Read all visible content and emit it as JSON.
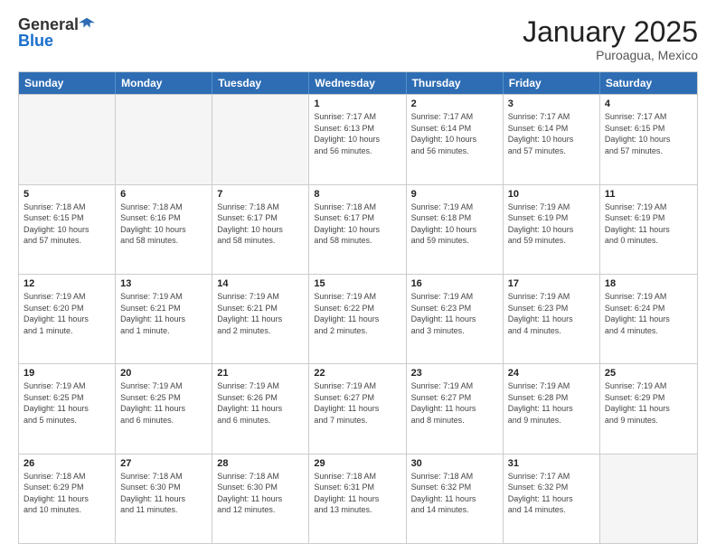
{
  "header": {
    "logo_general": "General",
    "logo_blue": "Blue",
    "month_year": "January 2025",
    "location": "Puroagua, Mexico"
  },
  "days_of_week": [
    "Sunday",
    "Monday",
    "Tuesday",
    "Wednesday",
    "Thursday",
    "Friday",
    "Saturday"
  ],
  "weeks": [
    [
      {
        "day": "",
        "info": ""
      },
      {
        "day": "",
        "info": ""
      },
      {
        "day": "",
        "info": ""
      },
      {
        "day": "1",
        "info": "Sunrise: 7:17 AM\nSunset: 6:13 PM\nDaylight: 10 hours\nand 56 minutes."
      },
      {
        "day": "2",
        "info": "Sunrise: 7:17 AM\nSunset: 6:14 PM\nDaylight: 10 hours\nand 56 minutes."
      },
      {
        "day": "3",
        "info": "Sunrise: 7:17 AM\nSunset: 6:14 PM\nDaylight: 10 hours\nand 57 minutes."
      },
      {
        "day": "4",
        "info": "Sunrise: 7:17 AM\nSunset: 6:15 PM\nDaylight: 10 hours\nand 57 minutes."
      }
    ],
    [
      {
        "day": "5",
        "info": "Sunrise: 7:18 AM\nSunset: 6:15 PM\nDaylight: 10 hours\nand 57 minutes."
      },
      {
        "day": "6",
        "info": "Sunrise: 7:18 AM\nSunset: 6:16 PM\nDaylight: 10 hours\nand 58 minutes."
      },
      {
        "day": "7",
        "info": "Sunrise: 7:18 AM\nSunset: 6:17 PM\nDaylight: 10 hours\nand 58 minutes."
      },
      {
        "day": "8",
        "info": "Sunrise: 7:18 AM\nSunset: 6:17 PM\nDaylight: 10 hours\nand 58 minutes."
      },
      {
        "day": "9",
        "info": "Sunrise: 7:19 AM\nSunset: 6:18 PM\nDaylight: 10 hours\nand 59 minutes."
      },
      {
        "day": "10",
        "info": "Sunrise: 7:19 AM\nSunset: 6:19 PM\nDaylight: 10 hours\nand 59 minutes."
      },
      {
        "day": "11",
        "info": "Sunrise: 7:19 AM\nSunset: 6:19 PM\nDaylight: 11 hours\nand 0 minutes."
      }
    ],
    [
      {
        "day": "12",
        "info": "Sunrise: 7:19 AM\nSunset: 6:20 PM\nDaylight: 11 hours\nand 1 minute."
      },
      {
        "day": "13",
        "info": "Sunrise: 7:19 AM\nSunset: 6:21 PM\nDaylight: 11 hours\nand 1 minute."
      },
      {
        "day": "14",
        "info": "Sunrise: 7:19 AM\nSunset: 6:21 PM\nDaylight: 11 hours\nand 2 minutes."
      },
      {
        "day": "15",
        "info": "Sunrise: 7:19 AM\nSunset: 6:22 PM\nDaylight: 11 hours\nand 2 minutes."
      },
      {
        "day": "16",
        "info": "Sunrise: 7:19 AM\nSunset: 6:23 PM\nDaylight: 11 hours\nand 3 minutes."
      },
      {
        "day": "17",
        "info": "Sunrise: 7:19 AM\nSunset: 6:23 PM\nDaylight: 11 hours\nand 4 minutes."
      },
      {
        "day": "18",
        "info": "Sunrise: 7:19 AM\nSunset: 6:24 PM\nDaylight: 11 hours\nand 4 minutes."
      }
    ],
    [
      {
        "day": "19",
        "info": "Sunrise: 7:19 AM\nSunset: 6:25 PM\nDaylight: 11 hours\nand 5 minutes."
      },
      {
        "day": "20",
        "info": "Sunrise: 7:19 AM\nSunset: 6:25 PM\nDaylight: 11 hours\nand 6 minutes."
      },
      {
        "day": "21",
        "info": "Sunrise: 7:19 AM\nSunset: 6:26 PM\nDaylight: 11 hours\nand 6 minutes."
      },
      {
        "day": "22",
        "info": "Sunrise: 7:19 AM\nSunset: 6:27 PM\nDaylight: 11 hours\nand 7 minutes."
      },
      {
        "day": "23",
        "info": "Sunrise: 7:19 AM\nSunset: 6:27 PM\nDaylight: 11 hours\nand 8 minutes."
      },
      {
        "day": "24",
        "info": "Sunrise: 7:19 AM\nSunset: 6:28 PM\nDaylight: 11 hours\nand 9 minutes."
      },
      {
        "day": "25",
        "info": "Sunrise: 7:19 AM\nSunset: 6:29 PM\nDaylight: 11 hours\nand 9 minutes."
      }
    ],
    [
      {
        "day": "26",
        "info": "Sunrise: 7:18 AM\nSunset: 6:29 PM\nDaylight: 11 hours\nand 10 minutes."
      },
      {
        "day": "27",
        "info": "Sunrise: 7:18 AM\nSunset: 6:30 PM\nDaylight: 11 hours\nand 11 minutes."
      },
      {
        "day": "28",
        "info": "Sunrise: 7:18 AM\nSunset: 6:30 PM\nDaylight: 11 hours\nand 12 minutes."
      },
      {
        "day": "29",
        "info": "Sunrise: 7:18 AM\nSunset: 6:31 PM\nDaylight: 11 hours\nand 13 minutes."
      },
      {
        "day": "30",
        "info": "Sunrise: 7:18 AM\nSunset: 6:32 PM\nDaylight: 11 hours\nand 14 minutes."
      },
      {
        "day": "31",
        "info": "Sunrise: 7:17 AM\nSunset: 6:32 PM\nDaylight: 11 hours\nand 14 minutes."
      },
      {
        "day": "",
        "info": ""
      }
    ]
  ]
}
